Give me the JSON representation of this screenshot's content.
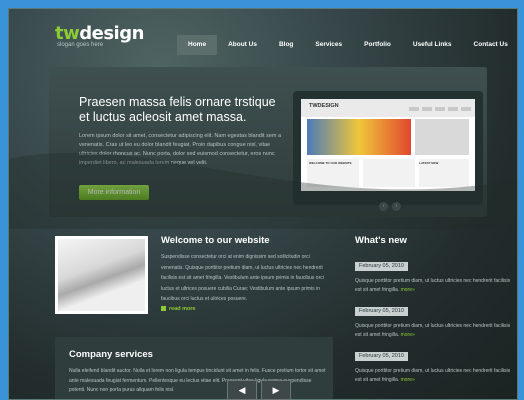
{
  "site": {
    "logo_prefix": "tw",
    "logo_suffix": "design",
    "slogan": "slogan goes here"
  },
  "nav": {
    "items": [
      {
        "label": "Home",
        "active": true
      },
      {
        "label": "About Us",
        "active": false
      },
      {
        "label": "Blog",
        "active": false
      },
      {
        "label": "Services",
        "active": false
      },
      {
        "label": "Portfolio",
        "active": false
      },
      {
        "label": "Useful Links",
        "active": false
      },
      {
        "label": "Contact Us",
        "active": false
      }
    ]
  },
  "hero": {
    "title": "Praesen massa felis ornare trstique et luctus acleosit amet massa.",
    "text": "Lorem ipsum dolor sit amet, consectetur adipiscing elit. Nam egestas blandit sem a venenatis. Cras ut leo eu dolor blandit feugiat. Proin dapibus congue nisl, vitae ultricies dolor rhoncus ac. Nunc porta, dolor sed euismod consectetur, eros nunc imperdiet libero, ac malesuada lorem neque vel velit.",
    "button_label": "More information",
    "screenshot": {
      "logo": "TWDESIGN",
      "welcome": "WELCOME TO OUR WEBSITE",
      "latest": "LATEST NEW"
    },
    "pager_prev": "‹",
    "pager_next": "›"
  },
  "welcome": {
    "title": "Welcome to our website",
    "text": "Suspendisse consectetur orci at enim dignissim sed sollicitudin orci venenatis. Quisque porttitor pretium diam, ut luctus ultricies nec hendrerit facilisis est sit amet fringilla. Vestibulum ante ipsum primis in faucibus orci luctus et ultrices posuere cubilia Curae; Vestibulum ante ipsum primis in faucibus orci luctus et ultrices posuere.",
    "read_more": "read more"
  },
  "news": {
    "title": "What's new",
    "items": [
      {
        "date": "February 05, 2010",
        "text": "Quisque porttitor pretium diam, ut luctus ultricies nec hendrerit facilisis est sit amet fringilla.",
        "more": "more»"
      },
      {
        "date": "February 05, 2010",
        "text": "Quisque porttitor pretium diam, ut luctus ultricies nec hendrerit facilisis est sit amet fringilla.",
        "more": "more»"
      },
      {
        "date": "February 05, 2010",
        "text": "Quisque porttitor pretium diam, ut luctus ultricies nec hendrerit facilisis est sit amet fringilla.",
        "more": "more»"
      }
    ]
  },
  "company": {
    "title": "Company services",
    "text": "Nulla eleifend blandit auctor. Nulla et lorem non ligula tempus tincidunt sit amet in felis. Fusce pretium tortor sit amet ante malesuada feugiat fermentum. Pellentesque eu lectus vitae elit. Praesent vitae ligula neque suspendisse potenti. Nunc non porta purus aliquam felis nisl."
  },
  "bottom_nav": {
    "prev": "◀",
    "next": "▶"
  },
  "colors": {
    "accent_green": "#8ccb33",
    "page_border": "#3a93d6"
  }
}
